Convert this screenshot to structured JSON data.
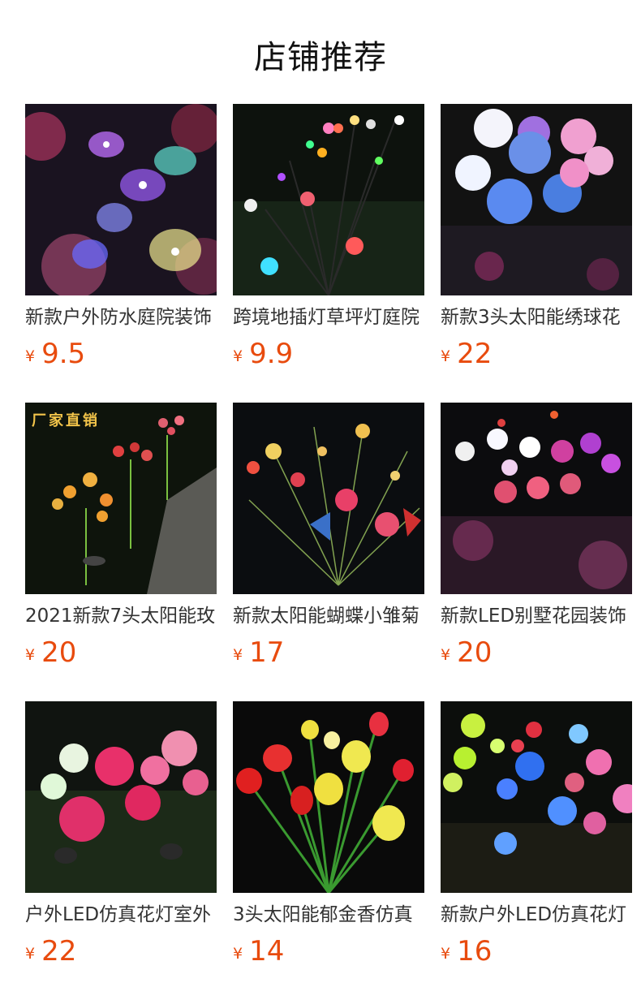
{
  "section_title": "店铺推荐",
  "currency": "¥",
  "products": [
    {
      "name": "新款户外防水庭院装饰",
      "price": "9.5",
      "image": "butterfly-lights"
    },
    {
      "name": "跨境地插灯草坪灯庭院",
      "price": "9.9",
      "image": "firefly-lights"
    },
    {
      "name": "新款3头太阳能绣球花",
      "price": "22",
      "image": "hydrangea-lights"
    },
    {
      "name": "2021新款7头太阳能玫",
      "price": "20",
      "image": "flower-stake-lights",
      "badge": "厂家直销"
    },
    {
      "name": "新款太阳能蝴蝶小雏菊",
      "price": "17",
      "image": "butterfly-daisy-lights"
    },
    {
      "name": "新款LED别墅花园装饰",
      "price": "20",
      "image": "orchid-lights"
    },
    {
      "name": "户外LED仿真花灯室外",
      "price": "22",
      "image": "peony-lights"
    },
    {
      "name": "3头太阳能郁金香仿真",
      "price": "14",
      "image": "tulip-lights"
    },
    {
      "name": "新款户外LED仿真花灯",
      "price": "16",
      "image": "rose-lights"
    }
  ]
}
